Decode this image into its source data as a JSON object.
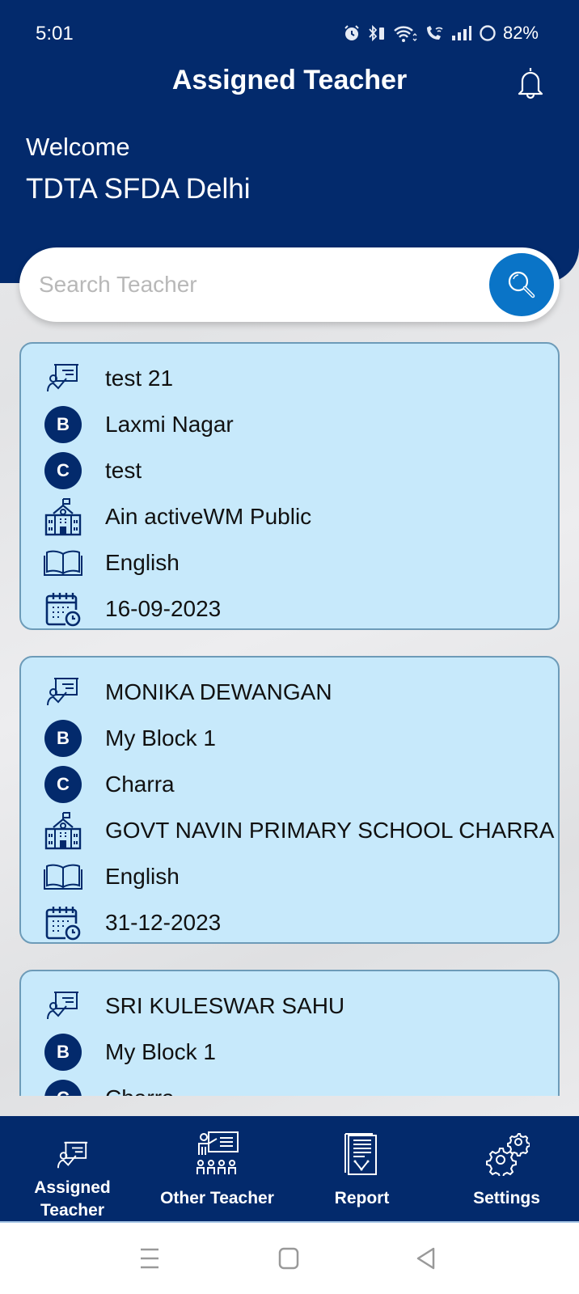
{
  "status_bar": {
    "time": "5:01",
    "battery": "82%",
    "icons": [
      "alarm-icon",
      "bluetooth-icon",
      "wifi-icon",
      "wifi-calling-icon",
      "signal-icon",
      "battery-icon"
    ]
  },
  "header": {
    "title": "Assigned Teacher",
    "notification_icon": "bell-icon",
    "welcome_label": "Welcome",
    "user_name": "TDTA SFDA Delhi"
  },
  "search": {
    "placeholder": "Search Teacher",
    "value": "",
    "button_icon": "search-icon"
  },
  "colors": {
    "primary": "#032a6c",
    "accent": "#0a74c7",
    "card_bg": "#c7e9fb"
  },
  "teachers": [
    {
      "name": "test 21",
      "block": "Laxmi Nagar",
      "cluster": "test",
      "school": "Ain activeWM Public",
      "subject": "English",
      "date": "16-09-2023"
    },
    {
      "name": "MONIKA DEWANGAN",
      "block": "My Block 1",
      "cluster": "Charra",
      "school": "GOVT NAVIN PRIMARY SCHOOL CHARRA",
      "subject": "English",
      "date": "31-12-2023"
    },
    {
      "name": "SRI KULESWAR SAHU",
      "block": "My Block 1",
      "cluster": "Charra",
      "school": "",
      "subject": "",
      "date": ""
    }
  ],
  "badges": {
    "block": "B",
    "cluster": "C"
  },
  "bottom_nav": [
    {
      "label": "Assigned Teacher",
      "icon": "teacher-board-icon",
      "active": true
    },
    {
      "label": "Other Teacher",
      "icon": "classroom-icon",
      "active": false
    },
    {
      "label": "Report",
      "icon": "report-icon",
      "active": false
    },
    {
      "label": "Settings",
      "icon": "settings-icon",
      "active": false
    }
  ]
}
